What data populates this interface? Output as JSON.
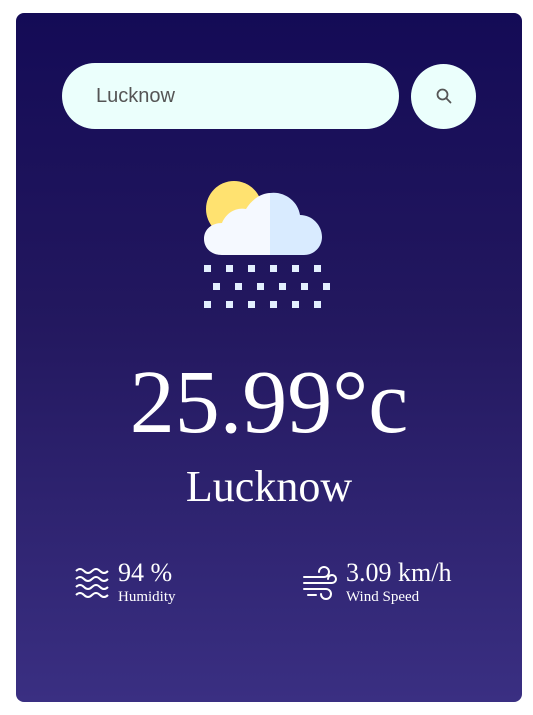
{
  "search": {
    "value": "Lucknow",
    "placeholder": ""
  },
  "weather": {
    "condition_icon": "cloud-sun-snow-icon",
    "temperature": "25.99°c",
    "city": "Lucknow"
  },
  "details": {
    "humidity": {
      "icon": "waves-icon",
      "value": "94 %",
      "label": "Humidity"
    },
    "wind": {
      "icon": "wind-icon",
      "value": "3.09 km/h",
      "label": "Wind Speed"
    }
  },
  "colors": {
    "card_top": "#140b56",
    "card_bottom": "#3a2f82",
    "input_bg": "#ebfffc",
    "sun": "#ffe270",
    "cloud_light": "#f5f9ff",
    "cloud_shade": "#d9ebff",
    "snow": "#e3efff"
  }
}
